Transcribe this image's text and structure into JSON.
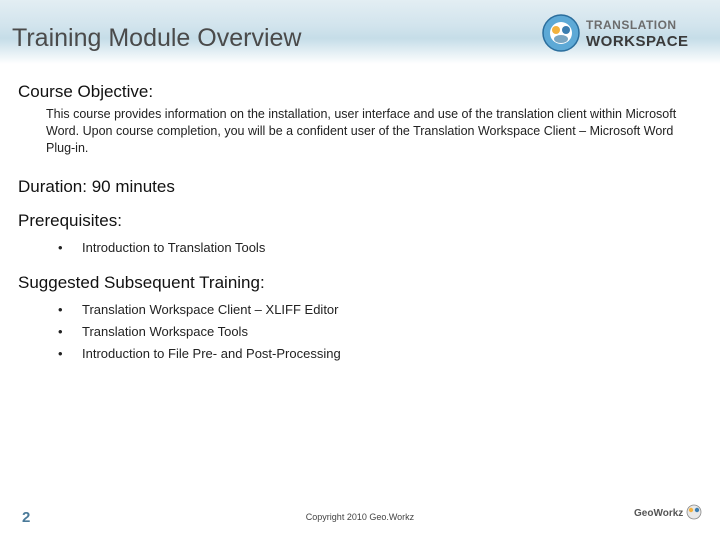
{
  "header": {
    "title": "Training Module Overview",
    "brand_top": "TRANSLATION",
    "brand_bottom": "WORKSPACE"
  },
  "objective": {
    "heading": "Course Objective:",
    "text": "This course provides information on the installation, user interface and use of the translation client within Microsoft Word. Upon course completion, you will be a confident user of the Translation Workspace Client – Microsoft Word Plug-in."
  },
  "duration_line": "Duration: 90 minutes",
  "prereq": {
    "heading": "Prerequisites:",
    "items": [
      "Introduction to Translation Tools"
    ]
  },
  "suggested": {
    "heading": "Suggested Subsequent Training:",
    "items": [
      "Translation Workspace Client – XLIFF Editor",
      "Translation Workspace Tools",
      "Introduction to File Pre- and Post-Processing"
    ]
  },
  "footer": {
    "page": "2",
    "copyright": "Copyright 2010 Geo.Workz",
    "logo_text": "GeoWorkz"
  }
}
